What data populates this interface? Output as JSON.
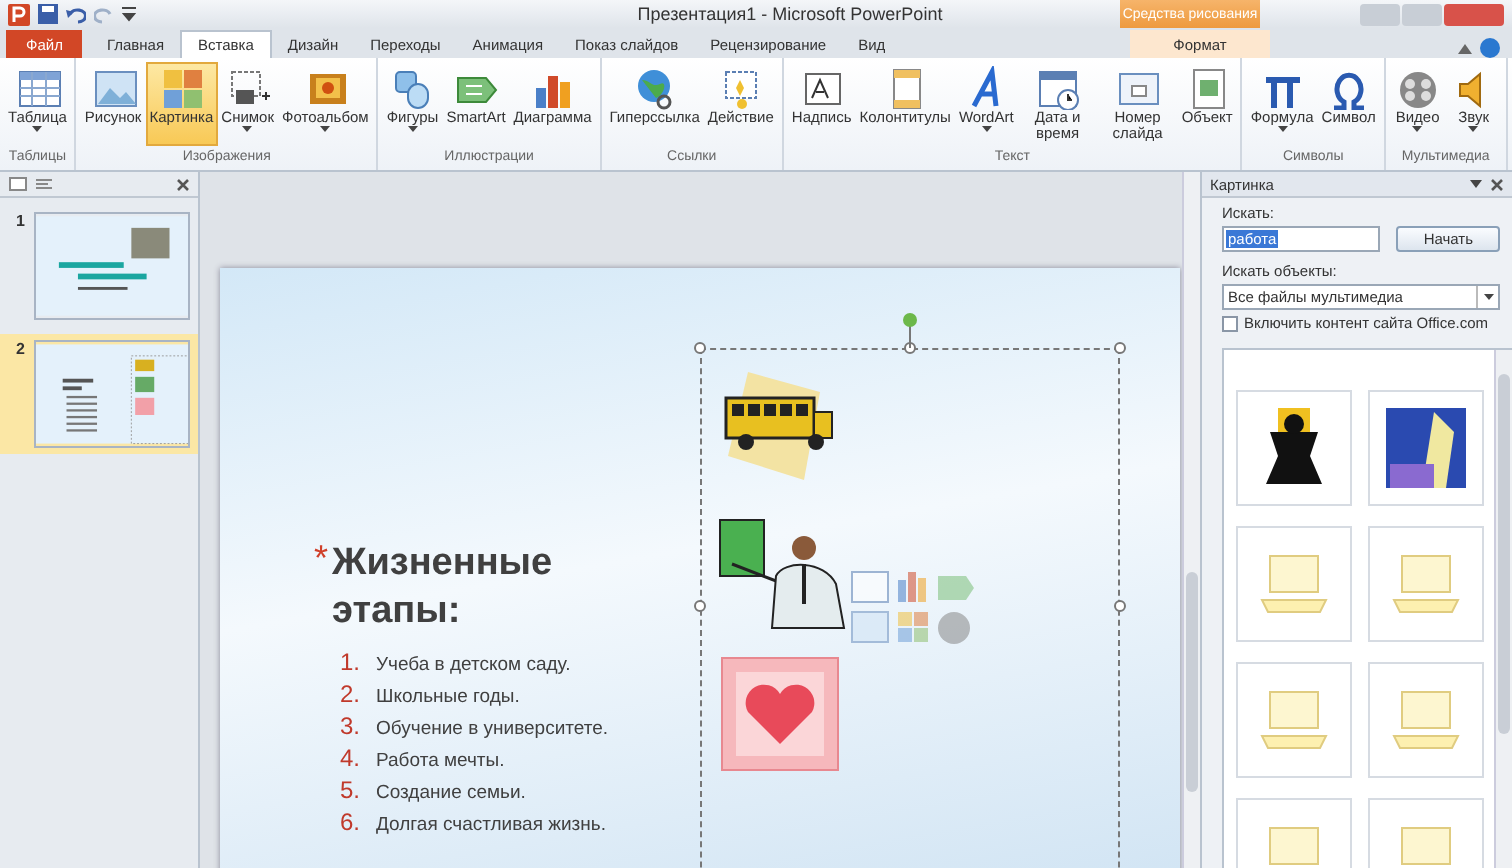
{
  "title_bar": {
    "title": "Презентация1 - Microsoft PowerPoint",
    "context_label": "Средства рисования"
  },
  "tabs": [
    {
      "label": "Файл",
      "kind": "file",
      "selected": false
    },
    {
      "label": "Главная",
      "kind": "normal",
      "selected": false
    },
    {
      "label": "Вставка",
      "kind": "normal",
      "selected": true
    },
    {
      "label": "Дизайн",
      "kind": "normal",
      "selected": false
    },
    {
      "label": "Переходы",
      "kind": "normal",
      "selected": false
    },
    {
      "label": "Анимация",
      "kind": "normal",
      "selected": false
    },
    {
      "label": "Показ слайдов",
      "kind": "normal",
      "selected": false
    },
    {
      "label": "Рецензирование",
      "kind": "normal",
      "selected": false
    },
    {
      "label": "Вид",
      "kind": "normal",
      "selected": false
    },
    {
      "label": "Формат",
      "kind": "context",
      "selected": false
    }
  ],
  "ribbon_groups": [
    {
      "label": "Таблицы",
      "buttons": [
        {
          "label": "Таблица",
          "kind": "menu",
          "selected": false
        }
      ]
    },
    {
      "label": "Изображения",
      "buttons": [
        {
          "label": "Рисунок",
          "kind": "plain",
          "selected": false
        },
        {
          "label": "Картинка",
          "kind": "plain",
          "selected": true
        },
        {
          "label": "Снимок",
          "kind": "menu",
          "selected": false
        },
        {
          "label": "Фотоальбом",
          "kind": "menu",
          "selected": false
        }
      ]
    },
    {
      "label": "Иллюстрации",
      "buttons": [
        {
          "label": "Фигуры",
          "kind": "menu",
          "selected": false
        },
        {
          "label": "SmartArt",
          "kind": "plain",
          "selected": false
        },
        {
          "label": "Диаграмма",
          "kind": "plain",
          "selected": false
        }
      ]
    },
    {
      "label": "Ссылки",
      "buttons": [
        {
          "label": "Гиперссылка",
          "kind": "plain",
          "selected": false
        },
        {
          "label": "Действие",
          "kind": "plain",
          "selected": false
        }
      ]
    },
    {
      "label": "Текст",
      "buttons": [
        {
          "label": "Надпись",
          "kind": "plain",
          "selected": false
        },
        {
          "label": "Колонтитулы",
          "kind": "plain",
          "selected": false
        },
        {
          "label": "WordArt",
          "kind": "menu",
          "selected": false
        },
        {
          "label": "Дата и время",
          "kind": "plain",
          "selected": false
        },
        {
          "label": "Номер слайда",
          "kind": "plain",
          "selected": false
        },
        {
          "label": "Объект",
          "kind": "plain",
          "selected": false
        }
      ]
    },
    {
      "label": "Символы",
      "buttons": [
        {
          "label": "Формула",
          "kind": "menu",
          "selected": false
        },
        {
          "label": "Символ",
          "kind": "plain",
          "selected": false
        }
      ]
    },
    {
      "label": "Мультимедиа",
      "buttons": [
        {
          "label": "Видео",
          "kind": "menu",
          "selected": false
        },
        {
          "label": "Звук",
          "kind": "menu",
          "selected": false
        }
      ]
    }
  ],
  "slides_panel": {
    "slides": [
      {
        "number": "1",
        "selected": false
      },
      {
        "number": "2",
        "selected": true
      }
    ]
  },
  "slide": {
    "title_mark": "*",
    "title": "Жизненные этапы:",
    "items": [
      {
        "number": "1.",
        "text": "Учеба в детском саду."
      },
      {
        "number": "2.",
        "text": "Школьные годы."
      },
      {
        "number": "3.",
        "text": "Обучение  в университете."
      },
      {
        "number": "4.",
        "text": "Работа мечты."
      },
      {
        "number": "5.",
        "text": "Создание семьи."
      },
      {
        "number": "6.",
        "text": "Долгая счастливая жизнь."
      }
    ]
  },
  "clip_art_pane": {
    "title": "Картинка",
    "search_label": "Искать:",
    "search_value": "работа",
    "search_button": "Начать",
    "type_label": "Искать объекты:",
    "type_value": "Все файлы мультимедиа",
    "office_checkbox": {
      "label": "Включить контент сайта Office.com",
      "checked": false
    }
  }
}
